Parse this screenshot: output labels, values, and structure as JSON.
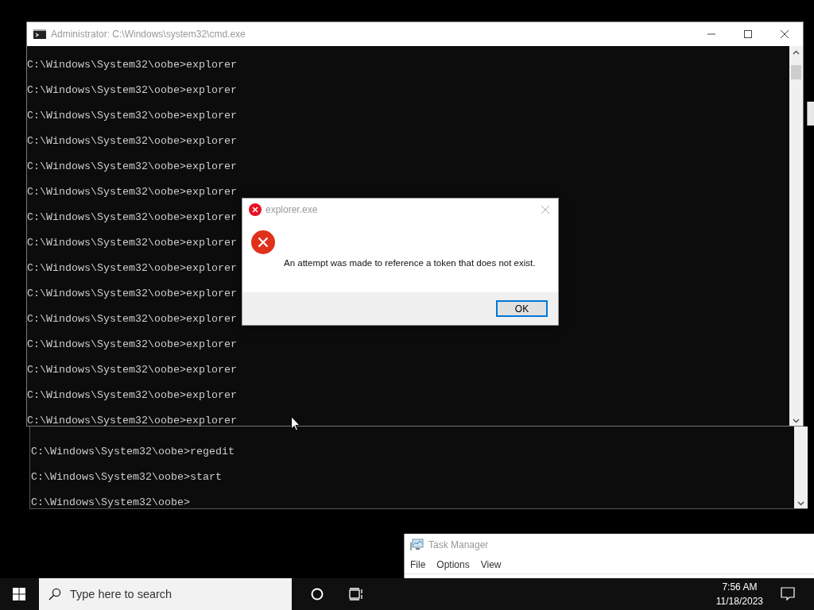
{
  "console_window": {
    "title": "Administrator: C:\\Windows\\system32\\cmd.exe",
    "lines": [
      "C:\\Windows\\System32\\oobe>explorer",
      "C:\\Windows\\System32\\oobe>explorer",
      "C:\\Windows\\System32\\oobe>explorer",
      "C:\\Windows\\System32\\oobe>explorer",
      "C:\\Windows\\System32\\oobe>explorer",
      "C:\\Windows\\System32\\oobe>explorer",
      "C:\\Windows\\System32\\oobe>explorer",
      "C:\\Windows\\System32\\oobe>explorer",
      "C:\\Windows\\System32\\oobe>explorer",
      "C:\\Windows\\System32\\oobe>explorer",
      "C:\\Windows\\System32\\oobe>explorer",
      "C:\\Windows\\System32\\oobe>explorer",
      "C:\\Windows\\System32\\oobe>explorer",
      "C:\\Windows\\System32\\oobe>explorer",
      "C:\\Windows\\System32\\oobe>explorer"
    ]
  },
  "background_console": {
    "lines": [
      "C:\\Windows\\System32\\oobe>regedit",
      "C:\\Windows\\System32\\oobe>start",
      "C:\\Windows\\System32\\oobe>"
    ]
  },
  "dialog": {
    "title": "explorer.exe",
    "message": "An attempt was made to reference a token that does not exist.",
    "buttons": [
      {
        "label": "OK",
        "selected": true
      }
    ]
  },
  "task_manager": {
    "title": "Task Manager",
    "menu": [
      "File",
      "Options",
      "View"
    ]
  },
  "taskbar": {
    "search": {
      "placeholder": "Type here to search"
    },
    "time": "7:56 AM",
    "date": "11/18/2023"
  }
}
